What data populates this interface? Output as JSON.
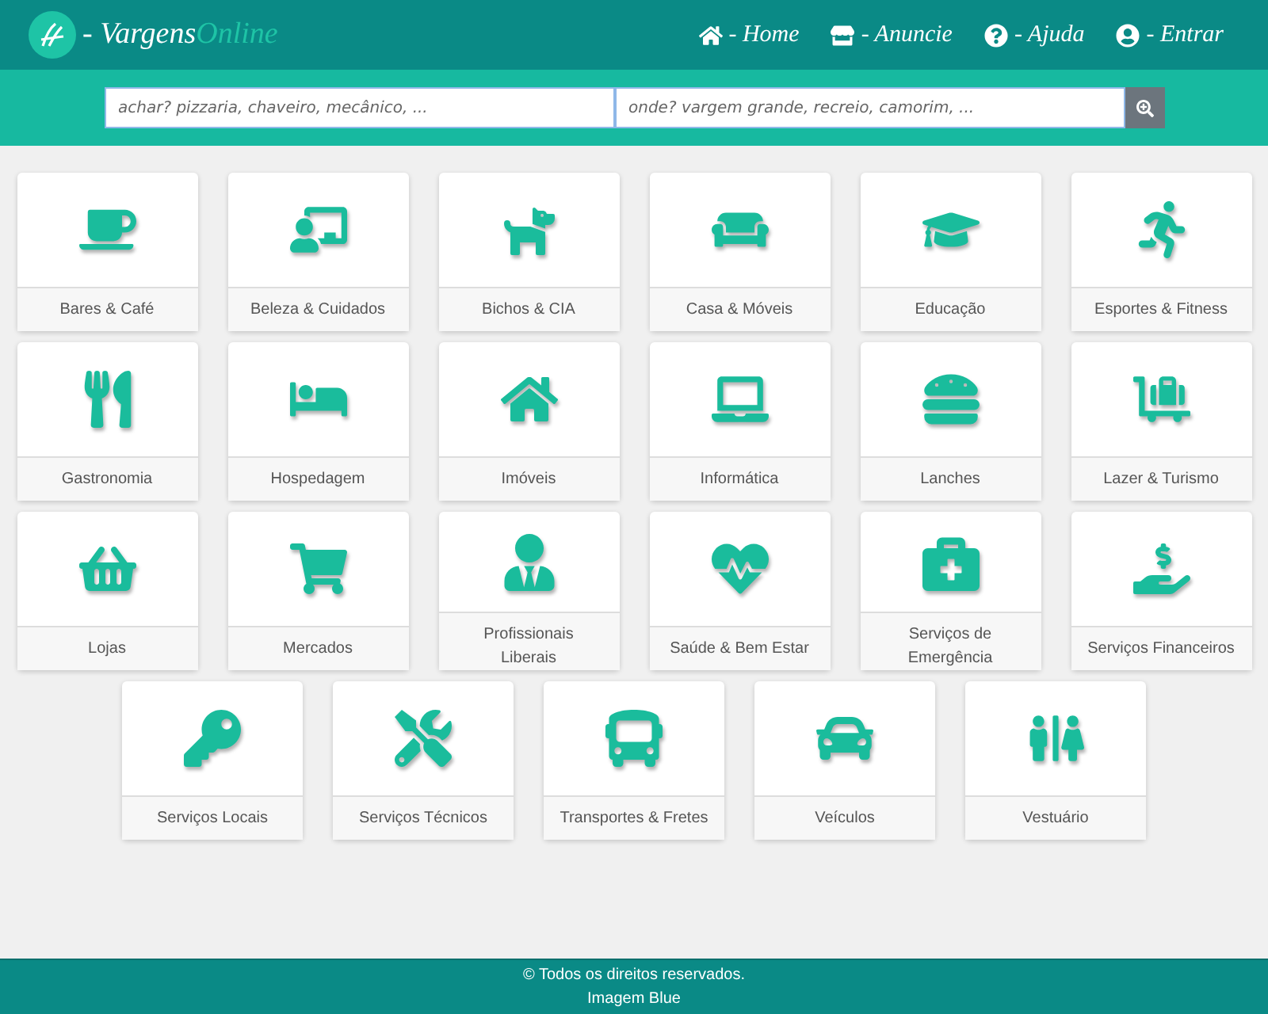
{
  "brand": {
    "name": "- Vargens",
    "highlight": "Online"
  },
  "nav": [
    {
      "label": "- Home"
    },
    {
      "label": "- Anuncie"
    },
    {
      "label": "- Ajuda"
    },
    {
      "label": "- Entrar"
    }
  ],
  "search": {
    "what_placeholder": "achar? pizzaria, chaveiro, mecânico, ...",
    "where_placeholder": "onde? vargem grande, recreio, camorim, ..."
  },
  "categories": [
    {
      "label": "Bares & Café"
    },
    {
      "label": "Beleza & Cuidados"
    },
    {
      "label": "Bichos & CIA"
    },
    {
      "label": "Casa & Móveis"
    },
    {
      "label": "Educação"
    },
    {
      "label": "Esportes & Fitness"
    },
    {
      "label": "Gastronomia"
    },
    {
      "label": "Hospedagem"
    },
    {
      "label": "Imóveis"
    },
    {
      "label": "Informática"
    },
    {
      "label": "Lanches"
    },
    {
      "label": "Lazer & Turismo"
    },
    {
      "label": "Lojas"
    },
    {
      "label": "Mercados"
    },
    {
      "label": "Profissionais Liberais"
    },
    {
      "label": "Saúde & Bem Estar"
    },
    {
      "label": "Serviços de Emergência"
    },
    {
      "label": "Serviços Financeiros"
    },
    {
      "label": "Serviços Locais"
    },
    {
      "label": "Serviços Técnicos"
    },
    {
      "label": "Transportes & Fretes"
    },
    {
      "label": "Veículos"
    },
    {
      "label": "Vestuário"
    }
  ],
  "footer": {
    "copyright": "© Todos os direitos reservados.",
    "credit": "Imagem Blue"
  }
}
